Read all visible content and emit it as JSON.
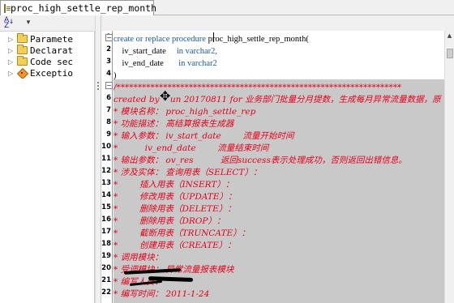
{
  "tab": {
    "title": "proc_high_settle_rep_month",
    "icon": "procedure-icon"
  },
  "navigator": {
    "items": [
      {
        "label": "Paramete",
        "icon": "folder-icon"
      },
      {
        "label": "Declarat",
        "icon": "folder-icon"
      },
      {
        "label": "Code sec",
        "icon": "folder-icon"
      },
      {
        "label": "Exceptio",
        "icon": "exception-icon"
      }
    ]
  },
  "editor": {
    "line_numbers": [
      "1",
      "2",
      "3",
      "4",
      "5",
      "6",
      "7",
      "8",
      "9",
      "10",
      "11",
      "12",
      "13",
      "14",
      "15",
      "16",
      "17",
      "18",
      "19",
      "20",
      "21",
      "22"
    ],
    "lines": [
      [
        {
          "t": "kw",
          "v": "create or replace procedure "
        },
        {
          "t": "plain",
          "v": "proc_high_settle_rep_month("
        }
      ],
      [
        {
          "t": "plain",
          "v": "    iv_start_date     "
        },
        {
          "t": "kw",
          "v": "in varchar2,"
        }
      ],
      [
        {
          "t": "plain",
          "v": "    iv_end_date       "
        },
        {
          "t": "kw",
          "v": "in varchar2"
        }
      ],
      [
        {
          "t": "plain",
          "v": ")"
        }
      ],
      [
        {
          "t": "cmt",
          "v": "/*******************************************************************"
        }
      ],
      [
        {
          "t": "cmt",
          "v": "created by    un 20170811 for 业务部门批量分月提数，生成每月异常流量数据，原"
        }
      ],
      [
        {
          "t": "cmt",
          "v": "* 模块名称： proc_high_settle_rep"
        }
      ],
      [
        {
          "t": "cmt",
          "v": "* 功能描述： 高结算报表生成器"
        }
      ],
      [
        {
          "t": "cmt",
          "v": "* 输入参数： iv_start_date        流量开始时间"
        }
      ],
      [
        {
          "t": "cmt",
          "v": "*          iv_end_date        流量结束时间"
        }
      ],
      [
        {
          "t": "cmt",
          "v": "* 输出参数： ov_res          返回success表示处理成功，否则返回出错信息。"
        }
      ],
      [
        {
          "t": "cmt",
          "v": "* 涉及实体： 查询用表（SELECT）："
        }
      ],
      [
        {
          "t": "cmt",
          "v": "*        插入用表（INSERT）："
        }
      ],
      [
        {
          "t": "cmt",
          "v": "*        修改用表（UPDATE）："
        }
      ],
      [
        {
          "t": "cmt",
          "v": "*        删除用表（DELETE）："
        }
      ],
      [
        {
          "t": "cmt",
          "v": "*        删除用表（DROP）："
        }
      ],
      [
        {
          "t": "cmt",
          "v": "*        截断用表（TRUNCATE）："
        }
      ],
      [
        {
          "t": "cmt",
          "v": "*        创建用表（CREATE）："
        }
      ],
      [
        {
          "t": "cmt",
          "v": "* 调用模块："
        }
      ],
      [
        {
          "t": "cmt",
          "v": "* 受调模块： 异常流量报表模块"
        }
      ],
      [
        {
          "t": "cmt",
          "v": "* 编写人员："
        }
      ],
      [
        {
          "t": "cmt",
          "v": "* 编写时间： 2011-1-24"
        }
      ]
    ]
  },
  "colors": {
    "keyword": "#1a57a4",
    "comment": "#e8001c",
    "comment_background": "#c9c9c9"
  }
}
